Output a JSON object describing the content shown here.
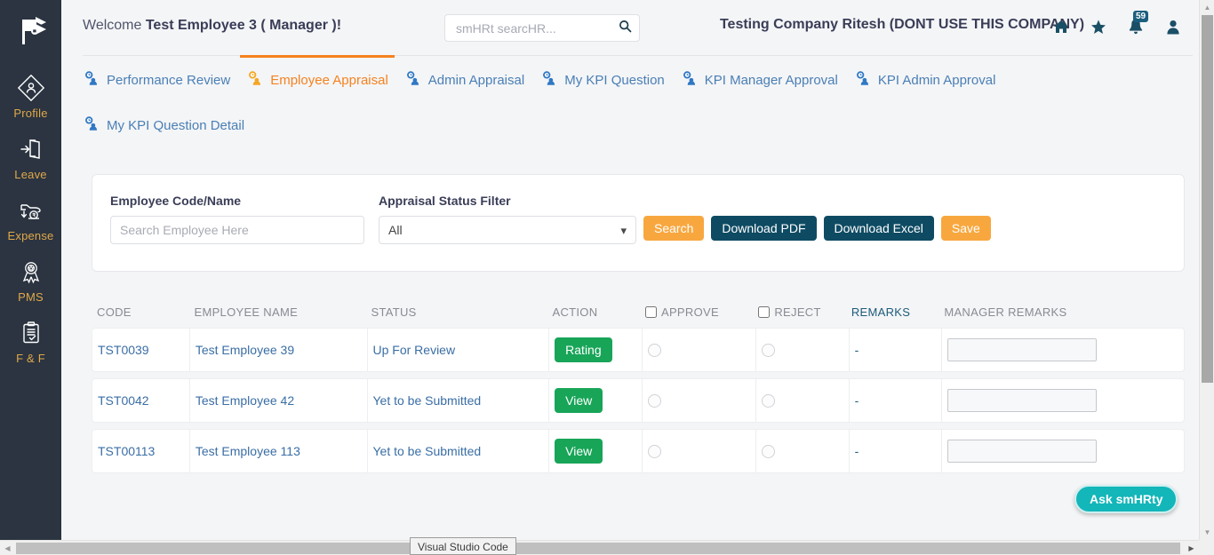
{
  "sidebar": {
    "logo_icon": "flag-wallet-logo",
    "items": [
      {
        "label": "Profile",
        "icon": "profile-diamond-icon"
      },
      {
        "label": "Leave",
        "icon": "door-exit-icon"
      },
      {
        "label": "Expense",
        "icon": "hand-rupee-icon"
      },
      {
        "label": "PMS",
        "icon": "award-ribbon-icon"
      },
      {
        "label": "F & F",
        "icon": "clipboard-check-icon"
      }
    ]
  },
  "header": {
    "welcome_prefix": "Welcome ",
    "welcome_user": "Test Employee 3 ( Manager )!",
    "company": "Testing Company Ritesh (DONT USE THIS COMPANY)",
    "search_placeholder": "smHRt searcHR...",
    "search_value": "",
    "search_icon": "search-icon",
    "icons": [
      {
        "name": "home-icon",
        "glyph": "⌂"
      },
      {
        "name": "star-icon",
        "glyph": "★"
      },
      {
        "name": "bell-icon",
        "glyph": "🔔"
      },
      {
        "name": "user-icon",
        "glyph": "👤"
      }
    ],
    "notification_count": "59"
  },
  "tabs": [
    {
      "label": "Performance Review",
      "active": false,
      "icon": "users-clock-icon"
    },
    {
      "label": "Employee Appraisal",
      "active": true,
      "icon": "users-clock-icon"
    },
    {
      "label": "Admin Appraisal",
      "active": false,
      "icon": "users-clock-icon"
    },
    {
      "label": "My KPI Question",
      "active": false,
      "icon": "users-clock-icon"
    },
    {
      "label": "KPI Manager Approval",
      "active": false,
      "icon": "users-clock-icon"
    },
    {
      "label": "KPI Admin Approval",
      "active": false,
      "icon": "users-clock-icon"
    },
    {
      "label": "My KPI Question Detail",
      "active": false,
      "icon": "users-clock-icon"
    }
  ],
  "filter": {
    "employee_label": "Employee Code/Name",
    "employee_placeholder": "Search Employee Here",
    "employee_value": "",
    "status_label": "Appraisal Status Filter",
    "status_value": "All",
    "status_options": [
      "All"
    ],
    "buttons": {
      "search": "Search",
      "download_pdf": "Download PDF",
      "download_excel": "Download Excel",
      "save": "Save"
    }
  },
  "table": {
    "headers": {
      "code": "CODE",
      "name": "EMPLOYEE NAME",
      "status": "STATUS",
      "action": "ACTION",
      "approve": "APPROVE",
      "reject": "REJECT",
      "remarks": "REMARKS",
      "manager_remarks": "MANAGER REMARKS"
    },
    "rows": [
      {
        "code": "TST0039",
        "name": "Test Employee 39",
        "status": "Up For Review",
        "action": "Rating",
        "remarks": "-",
        "manager_remarks": ""
      },
      {
        "code": "TST0042",
        "name": "Test Employee 42",
        "status": "Yet to be Submitted",
        "action": "View",
        "remarks": "-",
        "manager_remarks": ""
      },
      {
        "code": "TST00113",
        "name": "Test Employee 113",
        "status": "Yet to be Submitted",
        "action": "View",
        "remarks": "-",
        "manager_remarks": ""
      }
    ]
  },
  "chat": {
    "label": "Ask smHRty"
  },
  "taskbar": {
    "tooltip": "Visual Studio Code"
  },
  "colors": {
    "sidebar_bg": "#2b3440",
    "accent_orange": "#f5821f",
    "tab_blue": "#4a7fb5",
    "btn_dark": "#0e4b63",
    "btn_orange": "#f8a73f",
    "green": "#18a558",
    "teal": "#13b6b9"
  }
}
